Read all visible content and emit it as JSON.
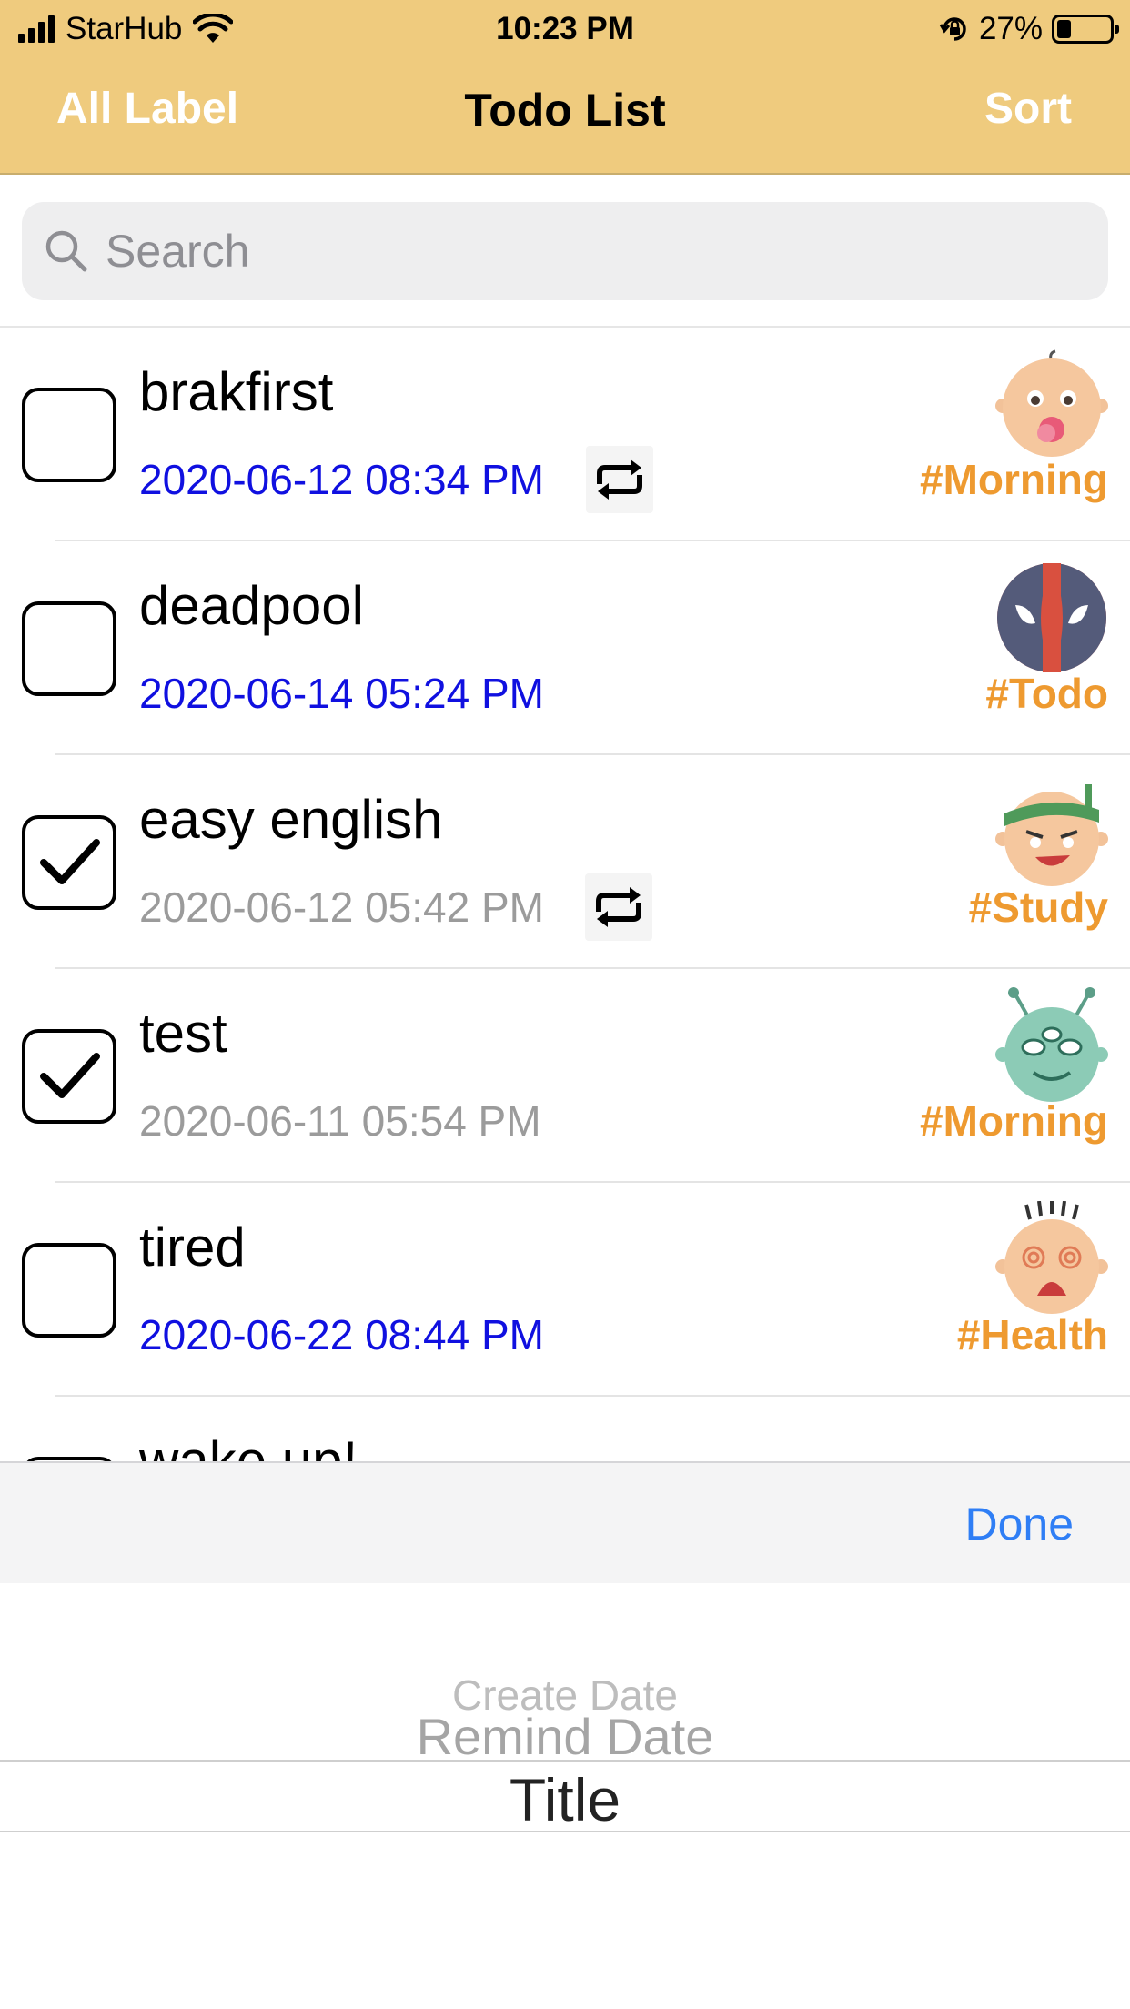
{
  "status_bar": {
    "carrier": "StarHub",
    "time": "10:23 PM",
    "battery_percent": "27%",
    "battery_level": 0.27,
    "icons": [
      "signal-bars-icon",
      "wifi-icon",
      "orientation-lock-icon",
      "battery-icon"
    ]
  },
  "nav": {
    "left_label": "All Label",
    "title": "Todo List",
    "right_label": "Sort",
    "bar_color": "#EFCB7E"
  },
  "search": {
    "placeholder": "Search",
    "value": ""
  },
  "colors": {
    "pending_date": "#1010E0",
    "done_date": "#9B9B9B",
    "label": "#EE9A30",
    "done_button": "#2F7EF5"
  },
  "todos": [
    {
      "title": "brakfirst",
      "date": "2020-06-12 08:34 PM",
      "checked": false,
      "repeat": true,
      "label": "#Morning",
      "avatar": "baby-pacifier-avatar"
    },
    {
      "title": "deadpool",
      "date": "2020-06-14 05:24 PM",
      "checked": false,
      "repeat": false,
      "label": "#Todo",
      "avatar": "deadpool-mask-avatar"
    },
    {
      "title": "easy english",
      "date": "2020-06-12 05:42 PM",
      "checked": true,
      "repeat": true,
      "label": "#Study",
      "avatar": "headband-face-avatar"
    },
    {
      "title": "test",
      "date": "2020-06-11 05:54 PM",
      "checked": true,
      "repeat": false,
      "label": "#Morning",
      "avatar": "green-alien-avatar"
    },
    {
      "title": "tired",
      "date": "2020-06-22 08:44 PM",
      "checked": false,
      "repeat": false,
      "label": "#Health",
      "avatar": "dizzy-face-avatar"
    },
    {
      "title": "wake up!",
      "date": "",
      "checked": false,
      "repeat": false,
      "label": "",
      "avatar": ""
    }
  ],
  "picker": {
    "done_label": "Done",
    "options": [
      "Create Date",
      "Remind Date",
      "Title"
    ],
    "selected": "Title"
  }
}
